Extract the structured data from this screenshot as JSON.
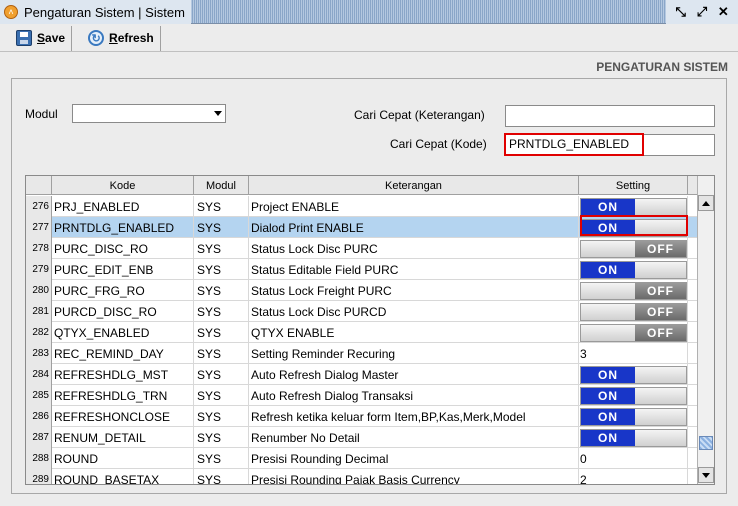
{
  "window": {
    "title": "Pengaturan Sistem | Sistem"
  },
  "toolbar": {
    "save_label": "Save",
    "save_underline": "S",
    "save_rest": "ave",
    "refresh_label": "Refresh",
    "refresh_underline": "R",
    "refresh_rest": "efresh"
  },
  "section_title": "PENGATURAN SISTEM",
  "filters": {
    "modul_label": "Modul",
    "modul_value": "",
    "cari_keterangan_label": "Cari Cepat (Keterangan)",
    "cari_keterangan_value": "",
    "cari_kode_label": "Cari Cepat (Kode)",
    "cari_kode_value": "PRNTDLG_ENABLED"
  },
  "table": {
    "columns": [
      "Kode",
      "Modul",
      "Keterangan",
      "Setting"
    ],
    "rows": [
      {
        "no": "276",
        "kode": "PRJ_ENABLED",
        "modul": "SYS",
        "keterangan": "Project ENABLE",
        "setting": "ON"
      },
      {
        "no": "277",
        "kode": "PRNTDLG_ENABLED",
        "modul": "SYS",
        "keterangan": "Dialod Print ENABLE",
        "setting": "ON"
      },
      {
        "no": "278",
        "kode": "PURC_DISC_RO",
        "modul": "SYS",
        "keterangan": "Status Lock Disc PURC",
        "setting": "OFF"
      },
      {
        "no": "279",
        "kode": "PURC_EDIT_ENB",
        "modul": "SYS",
        "keterangan": "Status Editable Field PURC",
        "setting": "ON"
      },
      {
        "no": "280",
        "kode": "PURC_FRG_RO",
        "modul": "SYS",
        "keterangan": "Status Lock Freight PURC",
        "setting": "OFF"
      },
      {
        "no": "281",
        "kode": "PURCD_DISC_RO",
        "modul": "SYS",
        "keterangan": "Status Lock Disc PURCD",
        "setting": "OFF"
      },
      {
        "no": "282",
        "kode": "QTYX_ENABLED",
        "modul": "SYS",
        "keterangan": "QTYX ENABLE",
        "setting": "OFF"
      },
      {
        "no": "283",
        "kode": "REC_REMIND_DAY",
        "modul": "SYS",
        "keterangan": "Setting Reminder Recuring",
        "setting": "3"
      },
      {
        "no": "284",
        "kode": "REFRESHDLG_MST",
        "modul": "SYS",
        "keterangan": "Auto Refresh Dialog Master",
        "setting": "ON"
      },
      {
        "no": "285",
        "kode": "REFRESHDLG_TRN",
        "modul": "SYS",
        "keterangan": "Auto Refresh Dialog Transaksi",
        "setting": "ON"
      },
      {
        "no": "286",
        "kode": "REFRESHONCLOSE",
        "modul": "SYS",
        "keterangan": "Refresh ketika keluar form Item,BP,Kas,Merk,Model",
        "setting": "ON"
      },
      {
        "no": "287",
        "kode": "RENUM_DETAIL",
        "modul": "SYS",
        "keterangan": "Renumber No Detail",
        "setting": "ON"
      },
      {
        "no": "288",
        "kode": "ROUND",
        "modul": "SYS",
        "keterangan": "Presisi Rounding Decimal",
        "setting": "0"
      },
      {
        "no": "289",
        "kode": "ROUND_BASETAX",
        "modul": "SYS",
        "keterangan": "Presisi Rounding Pajak Basis Currency",
        "setting": "2"
      }
    ],
    "selected_row": "277"
  },
  "colors": {
    "toggle_on": "#1836c8",
    "toggle_off": "#7a7a7a",
    "selected_row": "#b4d4f0",
    "highlight": "#e00000"
  },
  "icons": [
    "app-icon",
    "save-icon",
    "refresh-icon",
    "restore-icon",
    "maximize-icon",
    "close-icon"
  ]
}
